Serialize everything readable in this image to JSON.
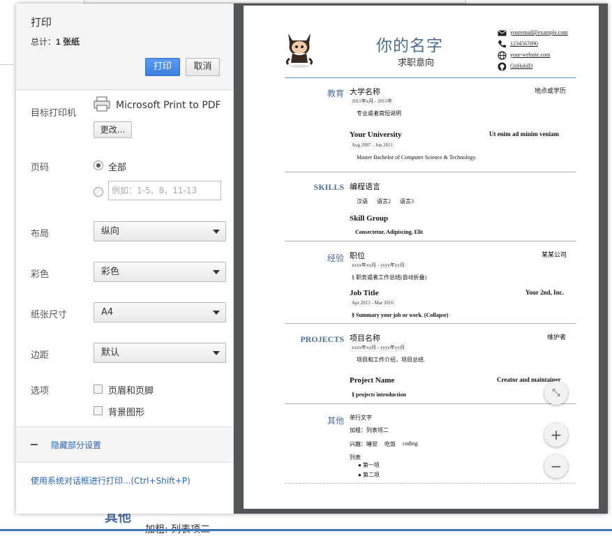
{
  "background": {
    "section_title": "其他",
    "row_text": "加粗: 列表项二"
  },
  "dialog": {
    "title": "打印",
    "total_prefix": "总计：",
    "total_value": "1 张纸",
    "print_button": "打印",
    "cancel_button": "取消",
    "destination_label": "目标打印机",
    "printer_name": "Microsoft Print to PDF",
    "change_button": "更改...",
    "pages_label": "页码",
    "pages_all": "全部",
    "pages_placeholder": "例如：1-5、8、11-13",
    "layout_label": "布局",
    "layout_value": "纵向",
    "color_label": "彩色",
    "color_value": "彩色",
    "paper_label": "纸张尺寸",
    "paper_value": "A4",
    "margins_label": "边距",
    "margins_value": "默认",
    "options_label": "选项",
    "option_headers": "页眉和页脚",
    "option_background": "背景图形",
    "less_settings": "隐藏部分设置",
    "system_dialog": "使用系统对话框进行打印...(Ctrl+Shift+P)"
  },
  "resume": {
    "name": "你的名字",
    "job_intent": "求职意向",
    "contacts": {
      "email": "youremail@example.com",
      "phone": "1234567890",
      "website": "your-website.com",
      "github": "GitHubID"
    },
    "education": {
      "title": "教育",
      "items": [
        {
          "school": "大学名称",
          "date": "2011年x月 - 2015年",
          "right": "地点或学历",
          "desc": "专业或者简短说明"
        },
        {
          "school": "Your University",
          "date": "Aug 2007 - Jun 2011",
          "right": "Ut enim ad minim veniam",
          "desc": "Master Bachelor of Computer Science & Technology."
        }
      ]
    },
    "skills": {
      "title": "SKILLS",
      "group1": "编程语言",
      "langs": [
        "汉语",
        "语言2",
        "语言3"
      ],
      "group2": "Skill Group",
      "group2_desc": "Consectetur, Adipiscing, Elit"
    },
    "experience": {
      "title": "经验",
      "items": [
        {
          "role": "职位",
          "date": "xxxx年xx月 - yyyy年yy月",
          "right": "某某公司",
          "desc": "§  职务或者工作总结(自动折叠)"
        },
        {
          "role": "Job Title",
          "date": "Apr 2013 - Mar 2016",
          "right": "Your 2nd, Inc.",
          "desc": "§  Summary your job or work. (Collapse)"
        }
      ]
    },
    "projects": {
      "title": "PROJECTS",
      "items": [
        {
          "name": "项目名称",
          "date": "xxxx年xx月 - yyyy年yy月",
          "right": "维护者",
          "desc": "项目和工作介绍，项目总结."
        },
        {
          "name": "Project Name",
          "right": "Creator and maintainer",
          "desc": "§  projects introduction"
        }
      ]
    },
    "other": {
      "title": "其他",
      "single": "单行文字",
      "bold_label": "加粗：",
      "bold_value": "列表项二",
      "hobby_label": "兴趣：",
      "hobbies": [
        "睡觉",
        "吃饭",
        "coding"
      ],
      "list_title": "列表",
      "list": [
        "第一项",
        "第二项"
      ]
    }
  },
  "fab": {
    "fit": "⤡",
    "zoom_in": "+",
    "zoom_out": "−"
  },
  "colors": {
    "accent": "#3c7fe0",
    "resume_title": "#4c6d94",
    "preview_bg": "#525659"
  }
}
